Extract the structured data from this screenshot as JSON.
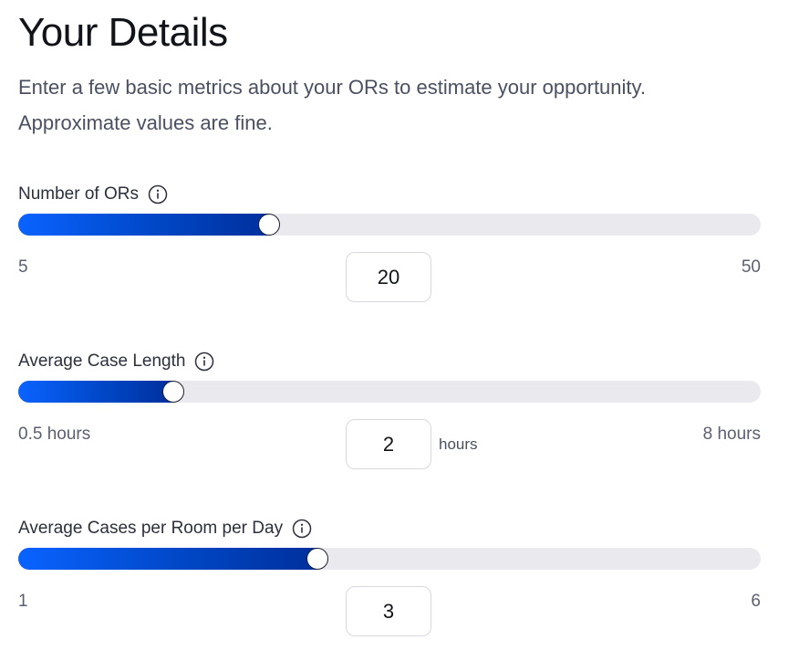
{
  "header": {
    "title": "Your Details",
    "intro_line1": "Enter a few basic metrics about your ORs to estimate your opportunity.",
    "intro_line2": "Approximate values are fine."
  },
  "fields": [
    {
      "label": "Number of ORs",
      "min_label": "5",
      "max_label": "50",
      "value": "20",
      "fill_fraction": 0.338,
      "unit": ""
    },
    {
      "label": "Average Case Length",
      "min_label": "0.5 hours",
      "max_label": "8 hours",
      "value": "2",
      "fill_fraction": 0.209,
      "unit": "hours"
    },
    {
      "label": "Average Cases per Room per Day",
      "min_label": "1",
      "max_label": "6",
      "value": "3",
      "fill_fraction": 0.403,
      "unit": ""
    }
  ],
  "colors": {
    "slider_fill_start": "#0a63ff",
    "slider_fill_end": "#002f9c",
    "track": "#e9e9ee"
  },
  "icons": {
    "info": "info-circle-icon"
  }
}
